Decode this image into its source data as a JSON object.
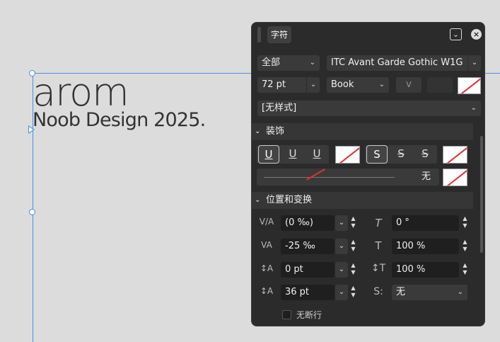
{
  "canvas": {
    "heading": "arom",
    "subheading": "Noob Design 2025."
  },
  "panel": {
    "tab_label": "字符",
    "collapse_icon": "chevron-down-icon",
    "close_icon": "close-icon",
    "font_collection": "全部",
    "font_family": "ITC Avant Garde Gothic W1G",
    "font_size": "72 pt",
    "font_style": "Book",
    "variable_font_label": "V",
    "paragraph_style": "[无样式]",
    "decoration": {
      "title": "装饰",
      "underline_buttons": [
        "U",
        "U",
        "U"
      ],
      "strike_buttons": [
        "S",
        "S",
        "S"
      ],
      "line_value": "无"
    },
    "position": {
      "title": "位置和变换",
      "kerning": "(0 ‰)",
      "tracking": "-25 ‰",
      "baseline_shift": "0 pt",
      "leading": "36 pt",
      "shear": "0 °",
      "horizontal_scale": "100 %",
      "vertical_scale": "100 %",
      "typographic_case": "无"
    },
    "no_break_label": "无断行"
  },
  "colors": {
    "accent": "#4a90e2",
    "panel_bg": "#2b2b2b",
    "none_swatch_line": "#e03030"
  }
}
